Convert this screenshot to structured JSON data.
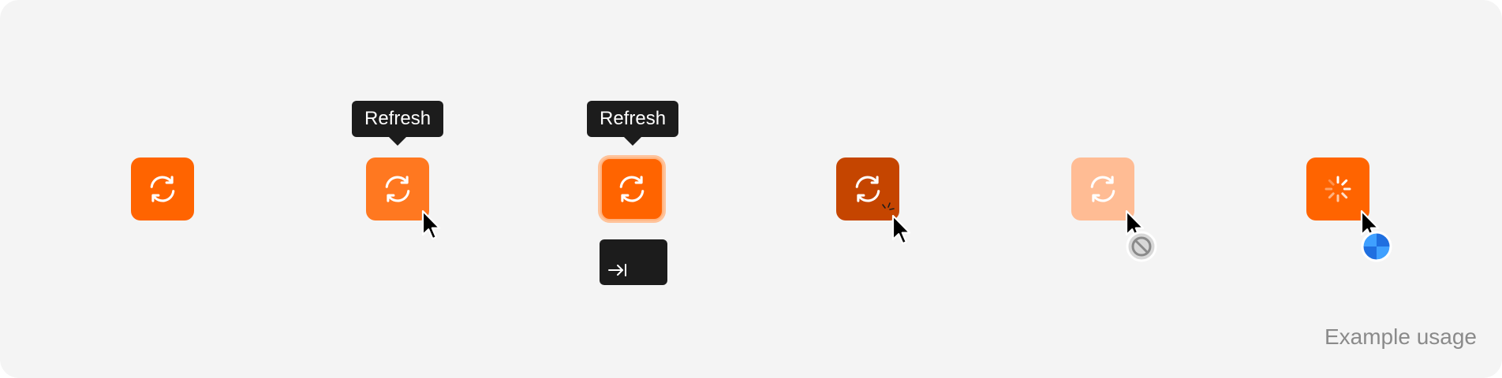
{
  "colors": {
    "panel_bg": "#f4f4f4",
    "accent": "#ff6400",
    "accent_hover": "#ff7820",
    "accent_pressed": "#c54500",
    "accent_disabled": "#ffbc94",
    "focus_ring": "#ffc39a",
    "tooltip_bg": "#1c1c1c",
    "caption_text": "#8a8a8a"
  },
  "states": [
    {
      "state": "default",
      "icon": "refresh-icon"
    },
    {
      "state": "hover",
      "icon": "refresh-icon",
      "tooltip": "Refresh",
      "cursor": "arrow-cursor-icon"
    },
    {
      "state": "focus",
      "icon": "refresh-icon",
      "tooltip": "Refresh",
      "key_hint_icon": "tab-key-icon"
    },
    {
      "state": "pressed",
      "icon": "refresh-icon",
      "cursor": "arrow-cursor-icon"
    },
    {
      "state": "disabled",
      "icon": "refresh-icon",
      "cursor": "not-allowed-cursor-icon"
    },
    {
      "state": "loading",
      "icon": "spinner-icon",
      "cursor": "progress-cursor-icon"
    }
  ],
  "tooltips": {
    "hover": "Refresh",
    "focus": "Refresh"
  },
  "caption": "Example usage"
}
